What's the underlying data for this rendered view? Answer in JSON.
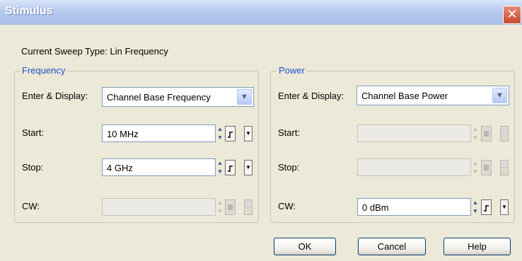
{
  "window": {
    "title": "Stimulus",
    "close_glyph": "✕"
  },
  "sweep": {
    "text": "Current Sweep Type:  Lin Frequency"
  },
  "frequency": {
    "group_title": "Frequency",
    "enter_display_label": "Enter & Display:",
    "enter_display_value": "Channel Base Frequency",
    "start_label": "Start:",
    "start_value": "10 MHz",
    "stop_label": "Stop:",
    "stop_value": "4 GHz",
    "cw_label": "CW:",
    "cw_value": ""
  },
  "power": {
    "group_title": "Power",
    "enter_display_label": "Enter & Display:",
    "enter_display_value": "Channel Base Power",
    "start_label": "Start:",
    "start_value": "",
    "stop_label": "Stop:",
    "stop_value": "",
    "cw_label": "CW:",
    "cw_value": "0 dBm"
  },
  "buttons": {
    "ok": "OK",
    "cancel": "Cancel",
    "help": "Help"
  },
  "icons": {
    "combo_arrow": "chevron-down-icon",
    "spin": "spin-up-down-icon",
    "step": "step-icon",
    "drop": "triangle-down-icon"
  },
  "colors": {
    "group_title": "#1c4fc4",
    "window_bg": "#ece9d8",
    "titlebar": "#b7cbee"
  }
}
